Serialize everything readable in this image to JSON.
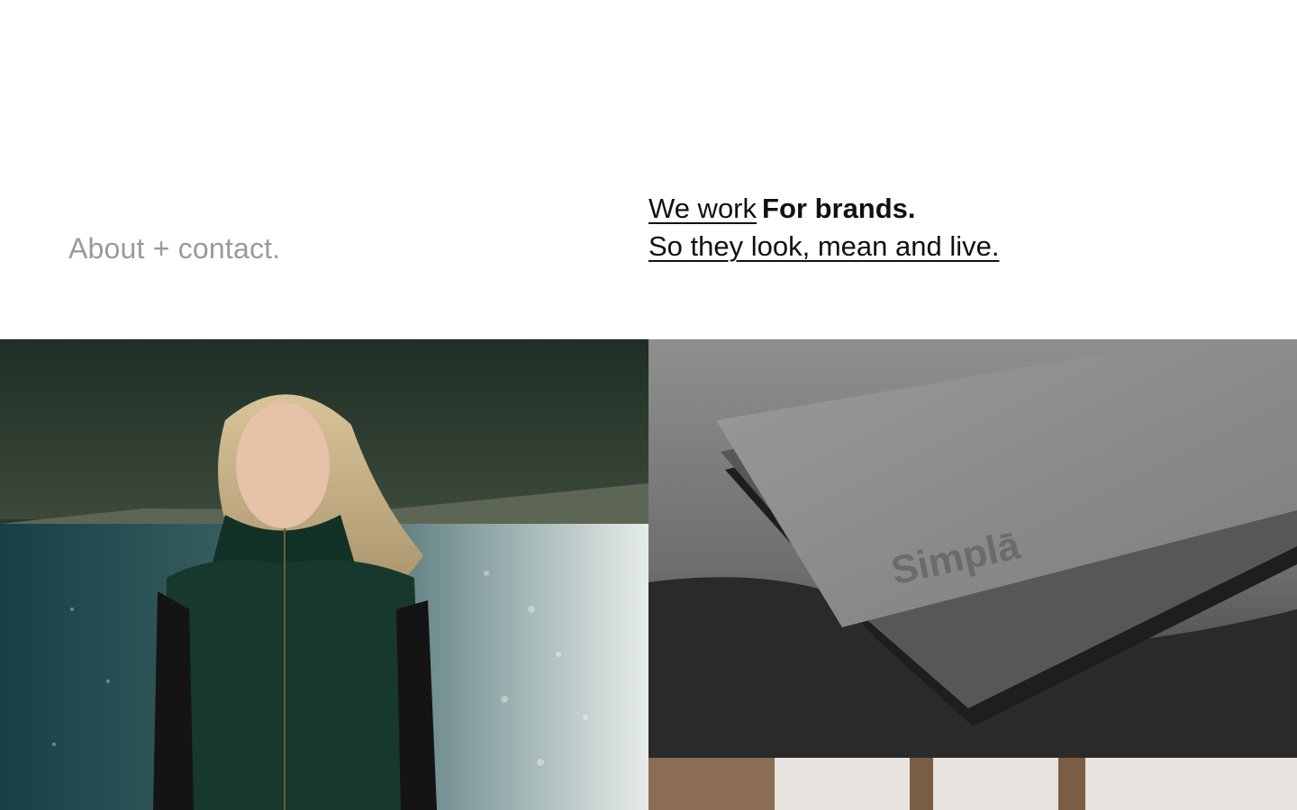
{
  "nav": {
    "about_link": "About + contact."
  },
  "intro": {
    "line1_link": "We work",
    "line1_bold": "For brands.",
    "line2_link": "So they look, mean and live."
  },
  "projects": [
    {
      "image": "woman-lake-photo"
    },
    {
      "image": "business-cards-photo",
      "card_text": "Simplā"
    },
    {
      "image": "interior-photo"
    }
  ]
}
